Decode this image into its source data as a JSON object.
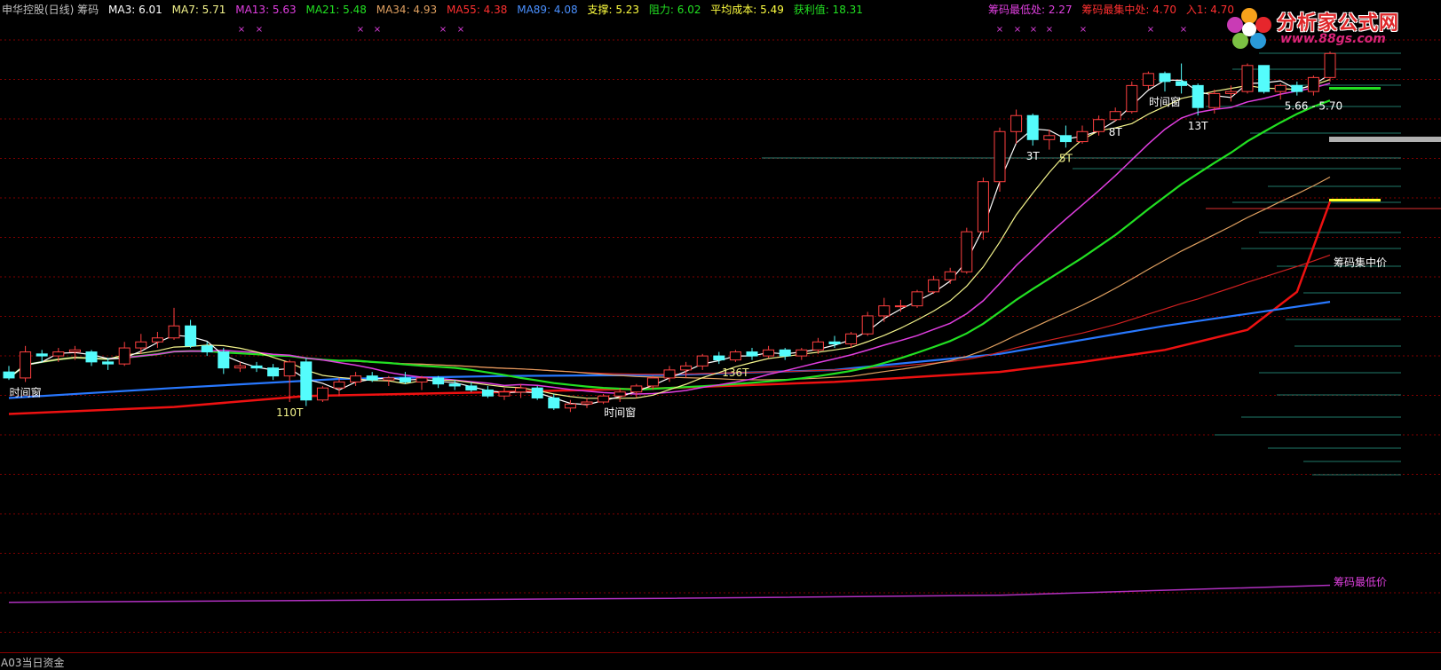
{
  "header": {
    "title": "申华控股(日线) 筹码",
    "ma3": "MA3: 6.01",
    "ma7": "MA7: 5.71",
    "ma13": "MA13: 5.63",
    "ma21": "MA21: 5.48",
    "ma34": "MA34: 4.93",
    "ma55": "MA55: 4.38",
    "ma89": "MA89: 4.08",
    "support": "支撑: 5.23",
    "resistance": "阻力: 6.02",
    "avg_cost": "平均成本: 5.49",
    "profit": "获利值: 18.31",
    "chip_low": "筹码最低处: 2.27",
    "chip_conc": "筹码最集中处: 4.70",
    "entry": "入1: 4.70"
  },
  "logo": {
    "name": "分析家公式网",
    "url": "www.88gs.com"
  },
  "bottom_panel_label": "A03当日资金",
  "colors": {
    "ma3": "#ffffff",
    "ma7": "#f5f58c",
    "ma13": "#e03ee0",
    "ma21": "#22e022",
    "ma34": "#e0a060",
    "ma55": "#d02020",
    "ma89": "#2878ff",
    "chip_conc": "#ee1111",
    "chip_low": "#b030c0",
    "up": "#ff4040",
    "down": "#54fcfc",
    "grid": "#800000"
  },
  "chart_data": {
    "type": "line",
    "ylim": [
      2.0,
      7.6
    ],
    "n": 81,
    "candles": [
      [
        4.4,
        4.46,
        4.32,
        4.34
      ],
      [
        4.34,
        4.66,
        4.3,
        4.6
      ],
      [
        4.58,
        4.62,
        4.5,
        4.56
      ],
      [
        4.56,
        4.64,
        4.5,
        4.6
      ],
      [
        4.6,
        4.66,
        4.52,
        4.62
      ],
      [
        4.6,
        4.62,
        4.46,
        4.5
      ],
      [
        4.5,
        4.54,
        4.42,
        4.48
      ],
      [
        4.48,
        4.7,
        4.46,
        4.64
      ],
      [
        4.64,
        4.78,
        4.58,
        4.7
      ],
      [
        4.7,
        4.8,
        4.64,
        4.74
      ],
      [
        4.74,
        5.04,
        4.72,
        4.86
      ],
      [
        4.86,
        4.92,
        4.64,
        4.66
      ],
      [
        4.66,
        4.7,
        4.56,
        4.6
      ],
      [
        4.6,
        4.64,
        4.38,
        4.44
      ],
      [
        4.44,
        4.5,
        4.4,
        4.46
      ],
      [
        4.46,
        4.5,
        4.4,
        4.44
      ],
      [
        4.44,
        4.48,
        4.32,
        4.36
      ],
      [
        4.36,
        4.52,
        4.1,
        4.5
      ],
      [
        4.5,
        4.54,
        4.06,
        4.12
      ],
      [
        4.12,
        4.26,
        4.1,
        4.24
      ],
      [
        4.24,
        4.34,
        4.16,
        4.3
      ],
      [
        4.3,
        4.4,
        4.26,
        4.36
      ],
      [
        4.36,
        4.4,
        4.3,
        4.32
      ],
      [
        4.32,
        4.36,
        4.26,
        4.34
      ],
      [
        4.34,
        4.4,
        4.28,
        4.3
      ],
      [
        4.3,
        4.36,
        4.22,
        4.34
      ],
      [
        4.34,
        4.36,
        4.24,
        4.28
      ],
      [
        4.28,
        4.32,
        4.22,
        4.26
      ],
      [
        4.26,
        4.3,
        4.2,
        4.22
      ],
      [
        4.22,
        4.26,
        4.14,
        4.16
      ],
      [
        4.16,
        4.24,
        4.12,
        4.2
      ],
      [
        4.2,
        4.28,
        4.14,
        4.24
      ],
      [
        4.24,
        4.26,
        4.12,
        4.14
      ],
      [
        4.14,
        4.18,
        4.02,
        4.04
      ],
      [
        4.04,
        4.12,
        4.0,
        4.08
      ],
      [
        4.08,
        4.14,
        4.04,
        4.1
      ],
      [
        4.1,
        4.18,
        4.08,
        4.16
      ],
      [
        4.16,
        4.24,
        4.1,
        4.2
      ],
      [
        4.2,
        4.28,
        4.14,
        4.26
      ],
      [
        4.26,
        4.36,
        4.22,
        4.34
      ],
      [
        4.34,
        4.46,
        4.3,
        4.42
      ],
      [
        4.42,
        4.5,
        4.34,
        4.46
      ],
      [
        4.46,
        4.58,
        4.42,
        4.56
      ],
      [
        4.56,
        4.6,
        4.48,
        4.52
      ],
      [
        4.52,
        4.62,
        4.5,
        4.6
      ],
      [
        4.6,
        4.64,
        4.52,
        4.56
      ],
      [
        4.56,
        4.66,
        4.54,
        4.62
      ],
      [
        4.62,
        4.64,
        4.52,
        4.56
      ],
      [
        4.56,
        4.64,
        4.52,
        4.62
      ],
      [
        4.62,
        4.74,
        4.58,
        4.7
      ],
      [
        4.7,
        4.76,
        4.64,
        4.68
      ],
      [
        4.68,
        4.8,
        4.64,
        4.78
      ],
      [
        4.78,
        5.0,
        4.76,
        4.96
      ],
      [
        4.96,
        5.14,
        4.9,
        5.06
      ],
      [
        5.06,
        5.12,
        5.0,
        5.06
      ],
      [
        5.06,
        5.22,
        5.04,
        5.2
      ],
      [
        5.2,
        5.36,
        5.18,
        5.32
      ],
      [
        5.32,
        5.44,
        5.28,
        5.4
      ],
      [
        5.4,
        5.84,
        5.38,
        5.8
      ],
      [
        5.8,
        6.34,
        5.72,
        6.3
      ],
      [
        6.3,
        6.84,
        6.2,
        6.8
      ],
      [
        6.8,
        7.02,
        6.68,
        6.96
      ],
      [
        6.96,
        6.98,
        6.66,
        6.72
      ],
      [
        6.72,
        6.82,
        6.62,
        6.76
      ],
      [
        6.76,
        6.86,
        6.64,
        6.7
      ],
      [
        6.7,
        6.86,
        6.68,
        6.8
      ],
      [
        6.8,
        6.96,
        6.76,
        6.92
      ],
      [
        6.92,
        7.04,
        6.9,
        7.0
      ],
      [
        7.0,
        7.3,
        6.98,
        7.26
      ],
      [
        7.26,
        7.4,
        7.22,
        7.38
      ],
      [
        7.38,
        7.4,
        7.2,
        7.3
      ],
      [
        7.3,
        7.48,
        7.18,
        7.26
      ],
      [
        7.26,
        7.28,
        6.96,
        7.04
      ],
      [
        7.04,
        7.22,
        6.98,
        7.18
      ],
      [
        7.18,
        7.26,
        7.1,
        7.2
      ],
      [
        7.2,
        7.48,
        7.18,
        7.46
      ],
      [
        7.46,
        7.44,
        7.18,
        7.2
      ],
      [
        7.2,
        7.28,
        7.12,
        7.26
      ],
      [
        7.26,
        7.3,
        7.16,
        7.2
      ],
      [
        7.2,
        7.36,
        7.16,
        7.34
      ],
      [
        7.34,
        7.6,
        7.3,
        7.58
      ]
    ],
    "ma89": [
      [
        0,
        4.14
      ],
      [
        10,
        4.24
      ],
      [
        20,
        4.33
      ],
      [
        30,
        4.36
      ],
      [
        40,
        4.37
      ],
      [
        50,
        4.42
      ],
      [
        60,
        4.58
      ],
      [
        70,
        4.86
      ],
      [
        80,
        5.1
      ]
    ],
    "chip_conc": [
      [
        0,
        3.98
      ],
      [
        10,
        4.05
      ],
      [
        18,
        4.16
      ],
      [
        30,
        4.2
      ],
      [
        40,
        4.24
      ],
      [
        50,
        4.3
      ],
      [
        60,
        4.4
      ],
      [
        65,
        4.5
      ],
      [
        70,
        4.62
      ],
      [
        75,
        4.82
      ],
      [
        78,
        5.2
      ],
      [
        80,
        6.1
      ]
    ],
    "chip_low": [
      [
        0,
        2.1
      ],
      [
        20,
        2.12
      ],
      [
        40,
        2.14
      ],
      [
        60,
        2.17
      ],
      [
        80,
        2.27
      ]
    ],
    "labels": [
      {
        "i": 1,
        "text": "时间窗",
        "color": "#ffffff"
      },
      {
        "i": 17,
        "text": "110T",
        "color": "#f5f58c"
      },
      {
        "i": 37,
        "text": "时间窗",
        "color": "#ffffff"
      },
      {
        "i": 44,
        "text": "136T",
        "color": "#f5f58c"
      },
      {
        "i": 62,
        "text": "3T",
        "color": "#ffffff"
      },
      {
        "i": 64,
        "text": "5T",
        "color": "#f5f58c"
      },
      {
        "i": 67,
        "text": "8T",
        "color": "#ffffff"
      },
      {
        "i": 70,
        "text": "时间窗",
        "color": "#ffffff"
      },
      {
        "i": 72,
        "text": "13T",
        "color": "#ffffff"
      },
      {
        "i": 79,
        "text": "5.66 - 5.70",
        "color": "#ffffff"
      }
    ],
    "side_labels": [
      "筹码集中价",
      "筹码最低价"
    ]
  }
}
